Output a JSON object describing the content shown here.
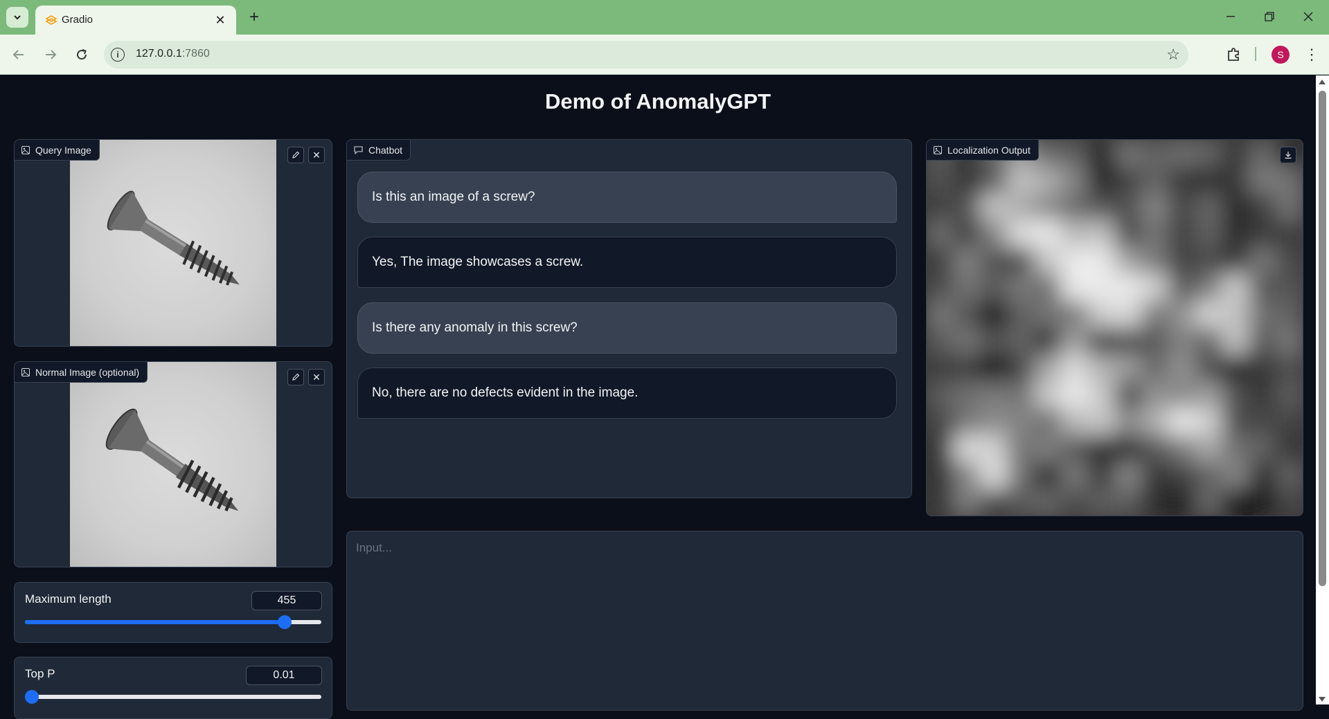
{
  "browser": {
    "tab_title": "Gradio",
    "url_host": "127.0.0.1",
    "url_port": ":7860",
    "profile_initial": "S"
  },
  "page": {
    "title": "Demo of AnomalyGPT"
  },
  "query_image": {
    "label": "Query Image"
  },
  "normal_image": {
    "label": "Normal Image (optional)"
  },
  "chatbot": {
    "label": "Chatbot",
    "messages": [
      {
        "role": "user",
        "text": "Is this an image of a screw?"
      },
      {
        "role": "bot",
        "text": "Yes, The image showcases a screw."
      },
      {
        "role": "user",
        "text": "Is there any anomaly in this screw?"
      },
      {
        "role": "bot",
        "text": "No, there are no defects evident in the image."
      }
    ]
  },
  "localization": {
    "label": "Localization Output"
  },
  "max_length": {
    "label": "Maximum length",
    "value": "455",
    "fraction": 0.875
  },
  "top_p": {
    "label": "Top P",
    "value": "0.01",
    "fraction": 0.0
  },
  "input": {
    "placeholder": "Input..."
  },
  "colors": {
    "accent": "#1d6ef5",
    "page_bg": "#0b0f19",
    "block_bg": "#1f2937",
    "chrome": "#7cba7b"
  }
}
